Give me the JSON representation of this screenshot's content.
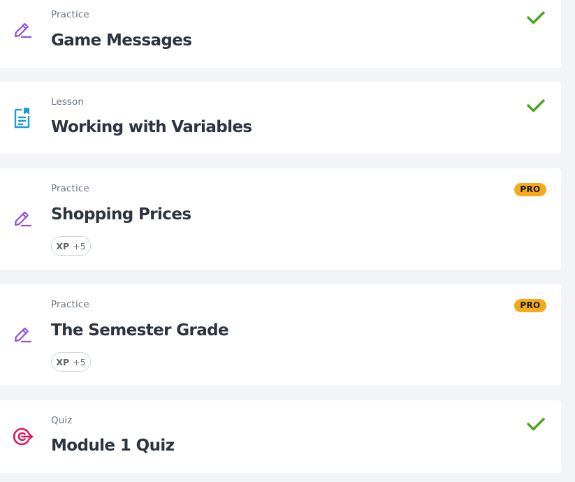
{
  "colors": {
    "practice_icon": "#8c51e0",
    "lesson_icon": "#1e9bd7",
    "quiz_icon": "#e0165a",
    "check": "#4aa51a",
    "pro_badge": "#f5a91b"
  },
  "items": [
    {
      "type": "Practice",
      "title": "Game Messages",
      "icon": "pencil-icon",
      "status": "completed"
    },
    {
      "type": "Lesson",
      "title": "Working with Variables",
      "icon": "lesson-document-icon",
      "status": "completed"
    },
    {
      "type": "Practice",
      "title": "Shopping Prices",
      "icon": "pencil-icon",
      "badge": "PRO",
      "xp_label": "XP",
      "xp_value": "+5"
    },
    {
      "type": "Practice",
      "title": "The Semester Grade",
      "icon": "pencil-icon",
      "badge": "PRO",
      "xp_label": "XP",
      "xp_value": "+5"
    },
    {
      "type": "Quiz",
      "title": "Module 1 Quiz",
      "icon": "target-icon",
      "status": "completed"
    }
  ]
}
